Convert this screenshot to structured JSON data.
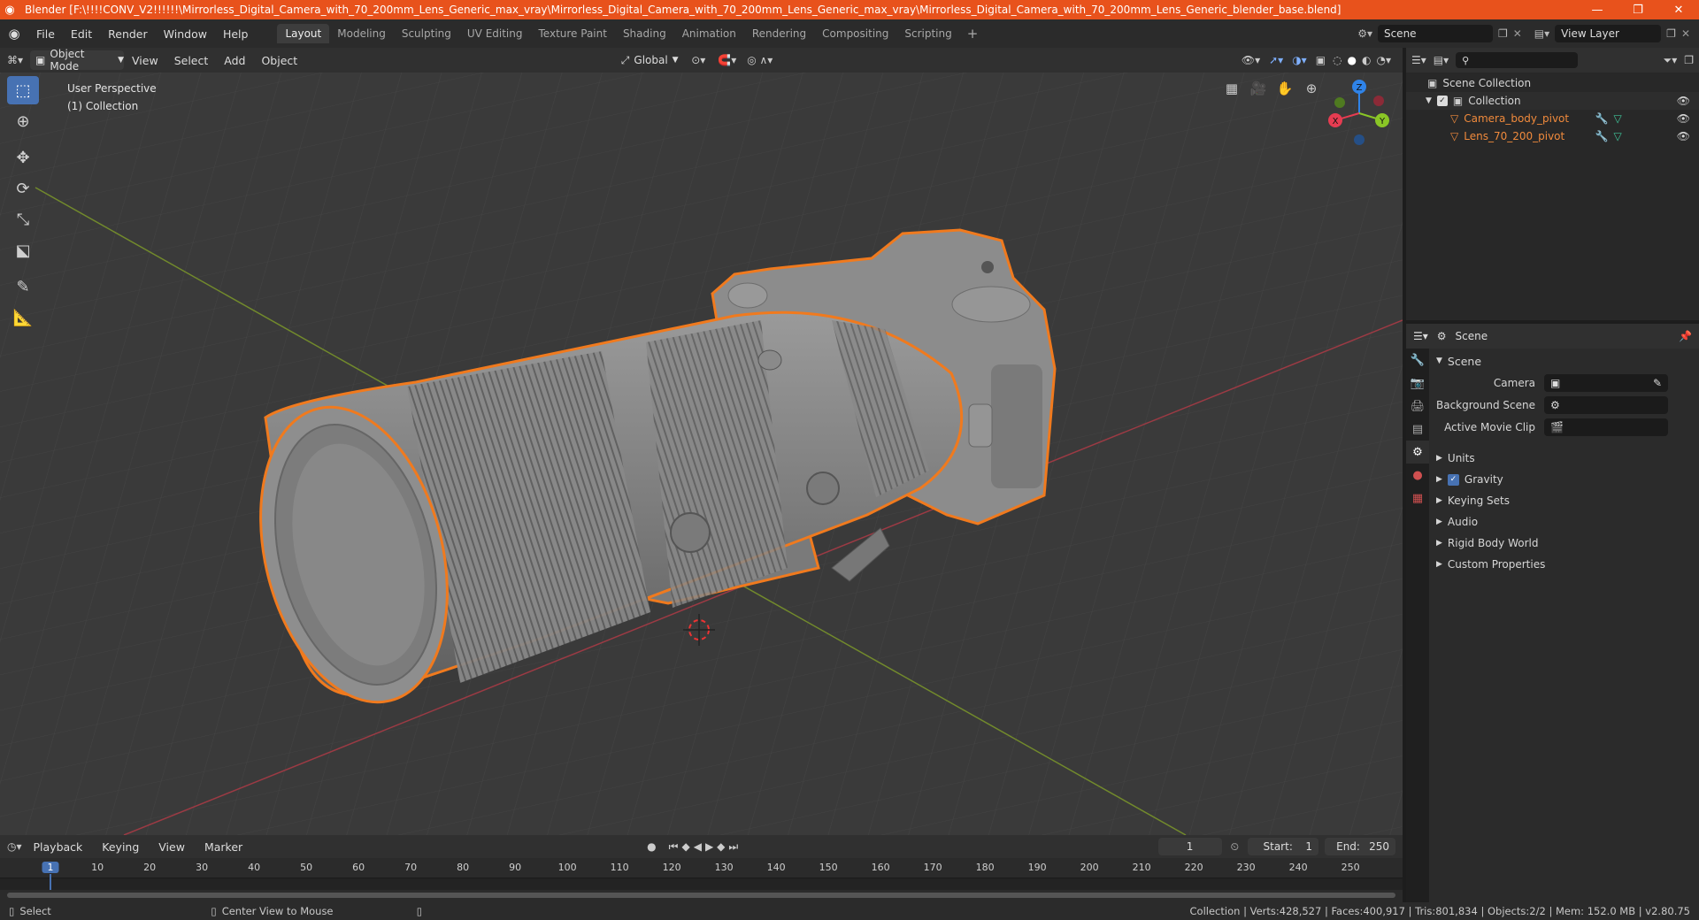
{
  "window": {
    "title": "Blender [F:\\!!!!CONV_V2!!!!!!\\Mirrorless_Digital_Camera_with_70_200mm_Lens_Generic_max_vray\\Mirrorless_Digital_Camera_with_70_200mm_Lens_Generic_max_vray\\Mirrorless_Digital_Camera_with_70_200mm_Lens_Generic_blender_base.blend]"
  },
  "menus": [
    "File",
    "Edit",
    "Render",
    "Window",
    "Help"
  ],
  "workspaces": [
    "Layout",
    "Modeling",
    "Sculpting",
    "UV Editing",
    "Texture Paint",
    "Shading",
    "Animation",
    "Rendering",
    "Compositing",
    "Scripting"
  ],
  "scene_field": "Scene",
  "view_layer_field": "View Layer",
  "viewport_header": {
    "mode": "Object Mode",
    "menus": [
      "View",
      "Select",
      "Add",
      "Object"
    ],
    "orientation": "Global"
  },
  "viewport": {
    "perspective": "User Perspective",
    "collection": "(1) Collection"
  },
  "gizmo": {
    "x": "X",
    "y": "Y",
    "z": "Z"
  },
  "outliner": {
    "root": "Scene Collection",
    "collection": "Collection",
    "objects": [
      "Camera_body_pivot",
      "Lens_70_200_pivot"
    ]
  },
  "properties": {
    "header": "Scene",
    "panel": "Scene",
    "fields": {
      "camera": "Camera",
      "background_scene": "Background Scene",
      "active_movie_clip": "Active Movie Clip"
    },
    "subpanels": [
      "Units",
      "Gravity",
      "Keying Sets",
      "Audio",
      "Rigid Body World",
      "Custom Properties"
    ],
    "gravity_checked": true
  },
  "timeline": {
    "menus": [
      "Playback",
      "Keying",
      "View",
      "Marker"
    ],
    "current_frame": "1",
    "start_label": "Start:",
    "start": "1",
    "end_label": "End:",
    "end": "250",
    "ruler": [
      "1",
      "10",
      "20",
      "30",
      "40",
      "50",
      "60",
      "70",
      "80",
      "90",
      "100",
      "110",
      "120",
      "130",
      "140",
      "150",
      "160",
      "170",
      "180",
      "190",
      "200",
      "210",
      "220",
      "230",
      "240",
      "250"
    ]
  },
  "statusbar": {
    "left": "Select",
    "middle": "Center View to Mouse",
    "right": "Collection | Verts:428,527 | Faces:400,917 | Tris:801,834 | Objects:2/2 | Mem: 152.0 MB | v2.80.75"
  },
  "colors": {
    "title_bar": "#e8521c",
    "selection_outline": "#f07a1e",
    "active_tool": "#4772b3",
    "x_axis": "#e63c51",
    "y_axis": "#8ac626",
    "z_axis": "#2f83e8"
  }
}
